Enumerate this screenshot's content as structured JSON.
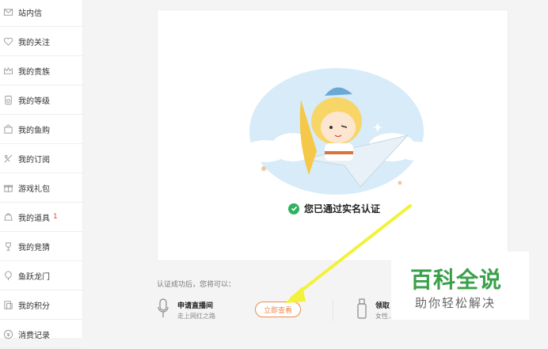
{
  "sidebar": {
    "items": [
      {
        "label": "站内信",
        "icon": "mail-icon"
      },
      {
        "label": "我的关注",
        "icon": "heart-icon"
      },
      {
        "label": "我的贵族",
        "icon": "crown-icon"
      },
      {
        "label": "我的等级",
        "icon": "medal-icon"
      },
      {
        "label": "我的鱼购",
        "icon": "bag-icon"
      },
      {
        "label": "我的订阅",
        "icon": "subscribe-icon"
      },
      {
        "label": "游戏礼包",
        "icon": "gift-icon"
      },
      {
        "label": "我的道具",
        "icon": "box-icon",
        "badge": "1"
      },
      {
        "label": "我的竞猜",
        "icon": "trophy-icon"
      },
      {
        "label": "鱼跃龙门",
        "icon": "balloon-icon"
      },
      {
        "label": "我的积分",
        "icon": "points-icon"
      },
      {
        "label": "消费记录",
        "icon": "coin-icon"
      }
    ]
  },
  "card": {
    "status_text": "您已通过实名认证"
  },
  "after": {
    "label": "认证成功后，您将可以："
  },
  "apply": {
    "title": "申请直播间",
    "subtitle": "走上网红之路",
    "button": "立即查看"
  },
  "receive": {
    "title": "领取",
    "subtitle": "女性..."
  },
  "watermark": {
    "main": "百科全说",
    "sub": "助你轻松解决"
  },
  "colors": {
    "accent": "#f08a4b",
    "success": "#2fb15f",
    "watermark": "#3aa04a",
    "arrow": "#f2f23a"
  }
}
